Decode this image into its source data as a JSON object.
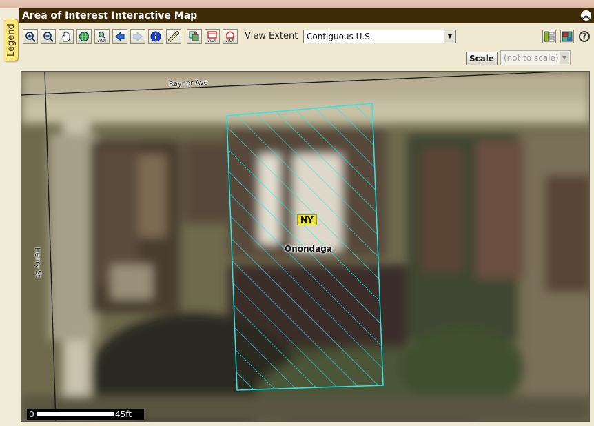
{
  "window": {
    "title": "Area of Interest Interactive Map"
  },
  "legend_tab": {
    "label": "Legend"
  },
  "toolbar": {
    "tools": [
      {
        "name": "zoom-in-icon"
      },
      {
        "name": "zoom-out-icon"
      },
      {
        "name": "pan-hand-icon"
      },
      {
        "name": "full-extent-globe-icon"
      },
      {
        "name": "zoom-to-aoi-icon",
        "text": "AOI"
      },
      {
        "name": "previous-extent-arrow-icon"
      },
      {
        "name": "next-extent-arrow-icon"
      },
      {
        "name": "identify-info-icon"
      },
      {
        "name": "measure-ruler-icon"
      },
      {
        "name": "select-features-icon"
      },
      {
        "name": "clear-aoi-icon",
        "text": "AOI"
      },
      {
        "name": "define-aoi-icon",
        "text": "AOI"
      }
    ],
    "view_extent_label": "View Extent",
    "view_extent_value": "Contiguous U.S."
  },
  "scale": {
    "button_label": "Scale",
    "select_value": "(not to scale)"
  },
  "map": {
    "roads": [
      "Raynor Ave",
      "Henry St"
    ],
    "state_label": "NY",
    "county_label": "Onondaga",
    "scalebar": {
      "start": "0",
      "end": "45ft"
    },
    "aoi_color": "#2ee6e6",
    "state_label_bg": "#e8e23a"
  },
  "colors": {
    "titlebar": "#3f2a08",
    "panel": "#efe9d2"
  }
}
